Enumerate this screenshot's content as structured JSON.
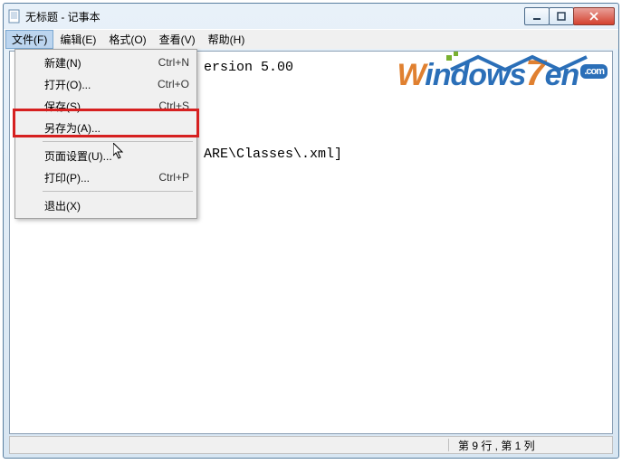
{
  "title": "无标题 - 记事本",
  "menubar": {
    "file": "文件(F)",
    "edit": "编辑(E)",
    "format": "格式(O)",
    "view": "查看(V)",
    "help": "帮助(H)"
  },
  "dropdown": {
    "new": {
      "label": "新建(N)",
      "shortcut": "Ctrl+N"
    },
    "open": {
      "label": "打开(O)...",
      "shortcut": "Ctrl+O"
    },
    "save": {
      "label": "保存(S)",
      "shortcut": "Ctrl+S"
    },
    "saveas": {
      "label": "另存为(A)...",
      "shortcut": ""
    },
    "pagesetup": {
      "label": "页面设置(U)...",
      "shortcut": ""
    },
    "print": {
      "label": "打印(P)...",
      "shortcut": "Ctrl+P"
    },
    "exit": {
      "label": "退出(X)",
      "shortcut": ""
    }
  },
  "content": {
    "line1_partial": "ersion 5.00",
    "line2_partial": "ARE\\Classes\\.xml]"
  },
  "statusbar": {
    "position": "第 9 行 , 第 1 列"
  },
  "watermark": {
    "brand_w": "W",
    "brand_rest": "indows",
    "brand_7": "7",
    "brand_en": "en",
    "com": ".com"
  }
}
